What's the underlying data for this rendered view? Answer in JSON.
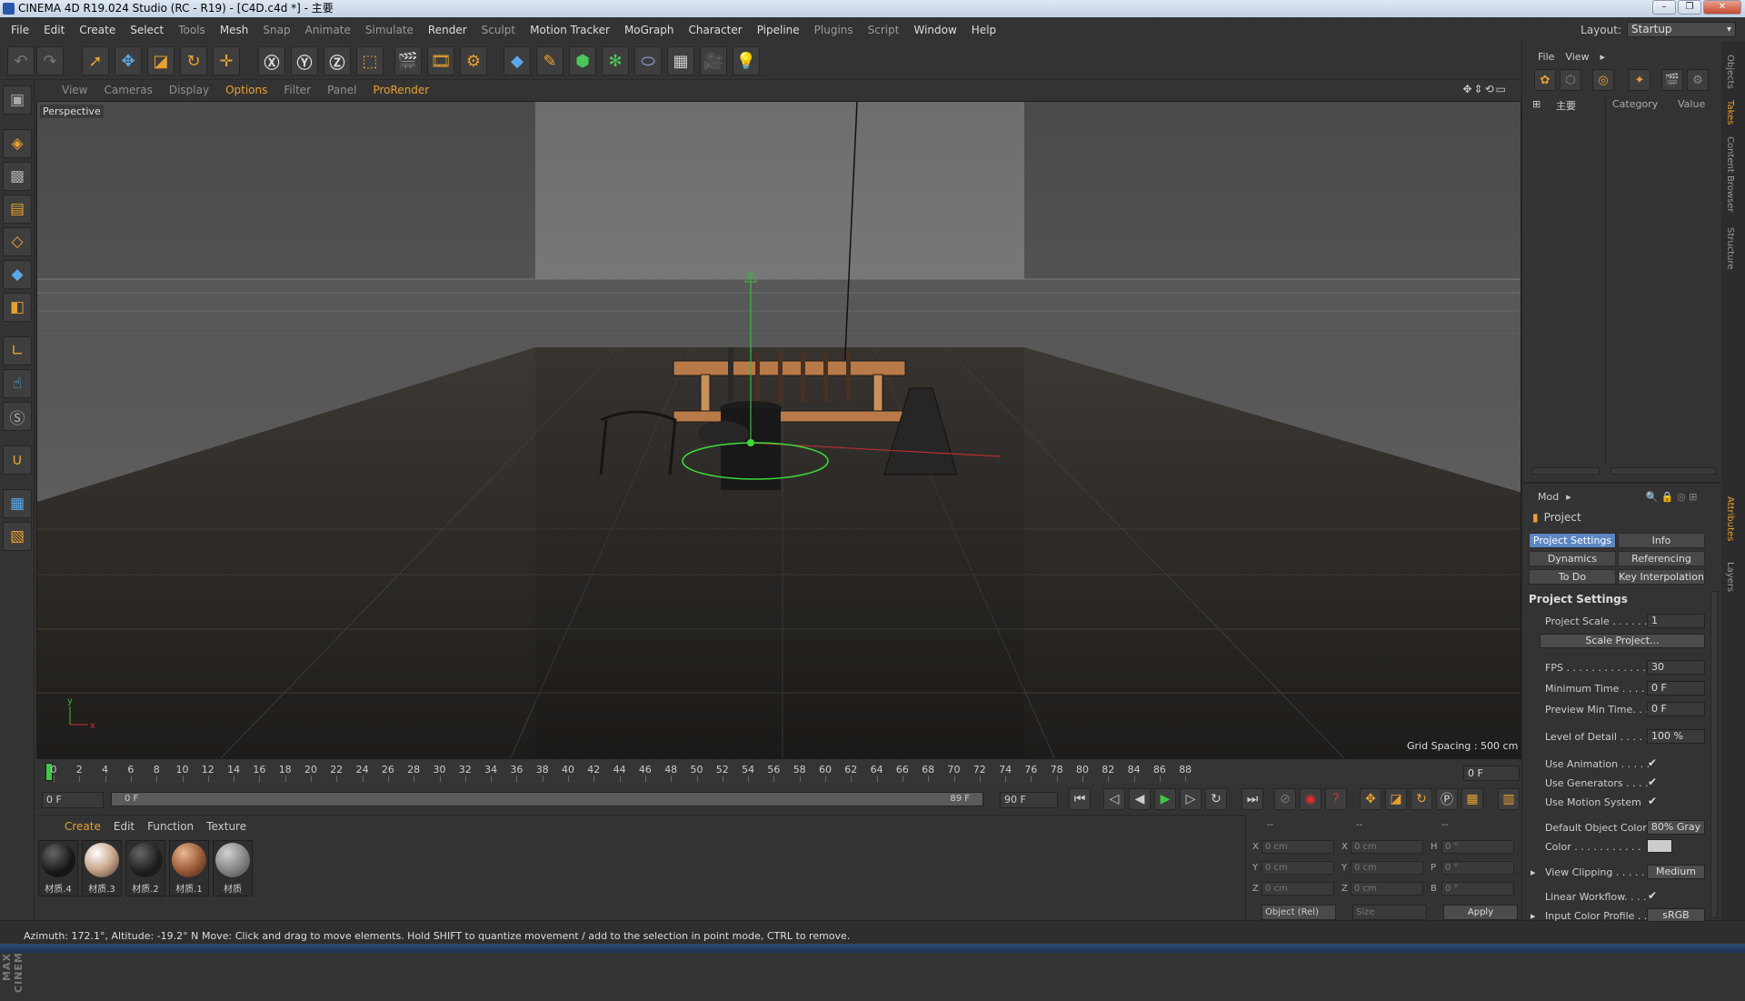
{
  "window": {
    "title": "CINEMA 4D R19.024 Studio (RC - R19) - [C4D.c4d *] - 主要"
  },
  "menu": [
    "File",
    "Edit",
    "Create",
    "Select",
    "Tools",
    "Mesh",
    "Snap",
    "Animate",
    "Simulate",
    "Render",
    "Sculpt",
    "Motion Tracker",
    "MoGraph",
    "Character",
    "Pipeline",
    "Plugins",
    "Script",
    "Window",
    "Help"
  ],
  "layout": {
    "label": "Layout:",
    "value": "Startup"
  },
  "viewport": {
    "menu": [
      "View",
      "Cameras",
      "Display",
      "Options",
      "Filter",
      "Panel",
      "ProRender"
    ],
    "active_menu": "Options",
    "label": "Perspective",
    "grid_spacing": "Grid Spacing : 500 cm"
  },
  "timeline": {
    "ticks": [
      "0",
      "2",
      "4",
      "6",
      "8",
      "10",
      "12",
      "14",
      "16",
      "18",
      "20",
      "22",
      "24",
      "26",
      "28",
      "30",
      "32",
      "34",
      "36",
      "38",
      "40",
      "42",
      "44",
      "46",
      "48",
      "50",
      "52",
      "54",
      "56",
      "58",
      "60",
      "62",
      "64",
      "66",
      "68",
      "70",
      "72",
      "74",
      "76",
      "78",
      "80",
      "82",
      "84",
      "86",
      "88"
    ],
    "current_frame": "0 F",
    "start_frame": "0 F",
    "slider_start": "0 F",
    "slider_end": "89 F",
    "end_frame": "90 F"
  },
  "materials": {
    "menu": [
      "Create",
      "Edit",
      "Function",
      "Texture"
    ],
    "items": [
      {
        "name": "材质.4",
        "color": "#161616"
      },
      {
        "name": "材质.3",
        "color": "#c9a88c"
      },
      {
        "name": "材质.2",
        "color": "#1c1c1c"
      },
      {
        "name": "材质.1",
        "color": "#a0603c"
      },
      {
        "name": "材质",
        "color": "#9a9a9a"
      }
    ]
  },
  "coordinates": {
    "headers": [
      "--",
      "--",
      "--"
    ],
    "rows": [
      {
        "a": "X",
        "a_val": "0 cm",
        "b": "X",
        "b_val": "0 cm",
        "c": "H",
        "c_val": "0 °"
      },
      {
        "a": "Y",
        "a_val": "0 cm",
        "b": "Y",
        "b_val": "0 cm",
        "c": "P",
        "c_val": "0 °"
      },
      {
        "a": "Z",
        "a_val": "0 cm",
        "b": "Z",
        "b_val": "0 cm",
        "c": "B",
        "c_val": "0 °"
      }
    ],
    "mode": "Object (Rel)",
    "size": "Size",
    "apply": "Apply"
  },
  "status": {
    "azimuth": "Azimuth: 172.1°, Altitude: -19.2°  N",
    "message": "Move: Click and drag to move elements. Hold SHIFT to quantize movement / add to the selection in point mode, CTRL to remove."
  },
  "objects": {
    "menu": [
      "File",
      "View"
    ],
    "root": "主要",
    "col_category": "Category",
    "col_value": "Value"
  },
  "attributes": {
    "mode": "Mod",
    "title": "Project",
    "tabs": [
      "Project Settings",
      "Info",
      "Dynamics",
      "Referencing",
      "To Do",
      "Key Interpolation"
    ],
    "section": "Project Settings",
    "rows": [
      {
        "label": "Project Scale . . . . . .",
        "value": "1"
      },
      {
        "label": "FPS . . . . . . . . . . . . . .",
        "value": "30"
      },
      {
        "label": "Minimum Time . . . . .",
        "value": "0 F"
      },
      {
        "label": "Preview Min Time. . .",
        "value": "0 F"
      },
      {
        "label": "Level of Detail . . . . .",
        "value": "100 %"
      }
    ],
    "scale_button": "Scale Project...",
    "checks": [
      "Use Animation . . . . .",
      "Use Generators . . . .",
      "Use Motion System"
    ],
    "default_color_label": "Default Object Color",
    "default_color_value": "80% Gray",
    "color_label": "Color . . . . . . . . . . .",
    "view_clipping_label": "View Clipping . . . . . .",
    "view_clipping_value": "Medium",
    "linear_workflow_label": "Linear Workflow. . . .",
    "input_profile_label": "Input Color Profile . .",
    "input_profile_value": "sRGB"
  },
  "side_tabs": [
    "Objects",
    "Takes",
    "Content Browser",
    "Structure",
    "Attributes",
    "Layers"
  ]
}
